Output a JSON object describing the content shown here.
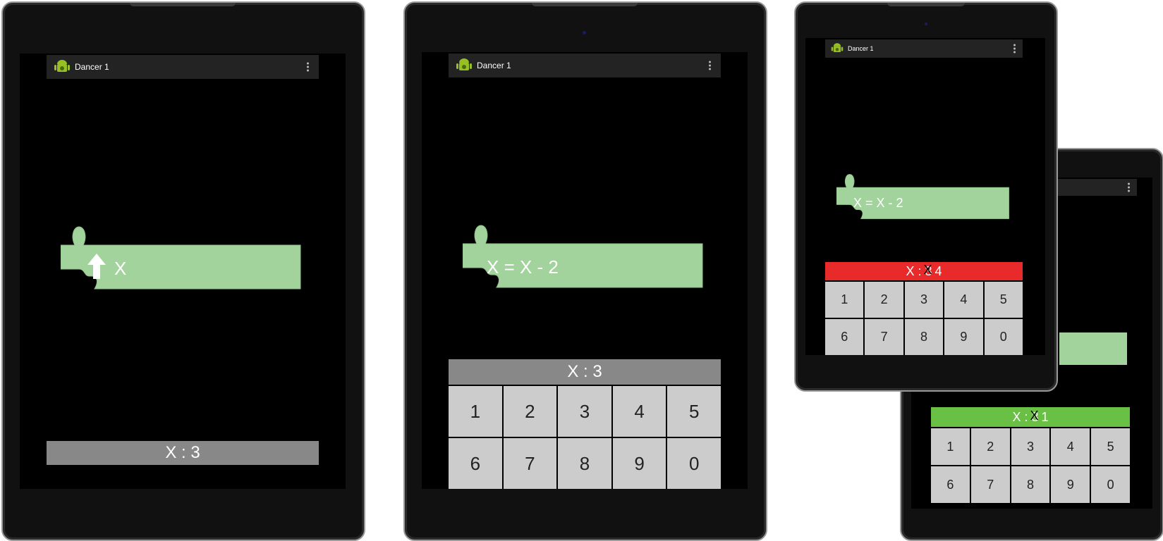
{
  "app": {
    "title": "Dancer 1"
  },
  "colors": {
    "block_green": "#a3d39c",
    "bar_gray": "#888888",
    "bar_red": "#e82a2a",
    "bar_green": "#6abf45",
    "key_gray": "#cccccc"
  },
  "icons": {
    "app": "android-app-icon",
    "overflow": "overflow-menu-icon",
    "up_arrow": "up-arrow-icon"
  },
  "tablet1": {
    "block_label": "X",
    "var_label": "X : 3"
  },
  "tablet2": {
    "block_label": "X = X - 2",
    "var_label": "X : 3",
    "keys": [
      "1",
      "2",
      "3",
      "4",
      "5",
      "6",
      "7",
      "8",
      "9",
      "0"
    ]
  },
  "tablet3": {
    "block_label": "X = X - 2",
    "var_prefix": "X : ",
    "var_old": "3",
    "var_new": "4",
    "keys": [
      "1",
      "2",
      "3",
      "4",
      "5",
      "6",
      "7",
      "8",
      "9",
      "0"
    ]
  },
  "tablet4": {
    "var_prefix": "X : ",
    "var_old": "3",
    "var_new": "1",
    "keys": [
      "1",
      "2",
      "3",
      "4",
      "5",
      "6",
      "7",
      "8",
      "9",
      "0"
    ]
  }
}
